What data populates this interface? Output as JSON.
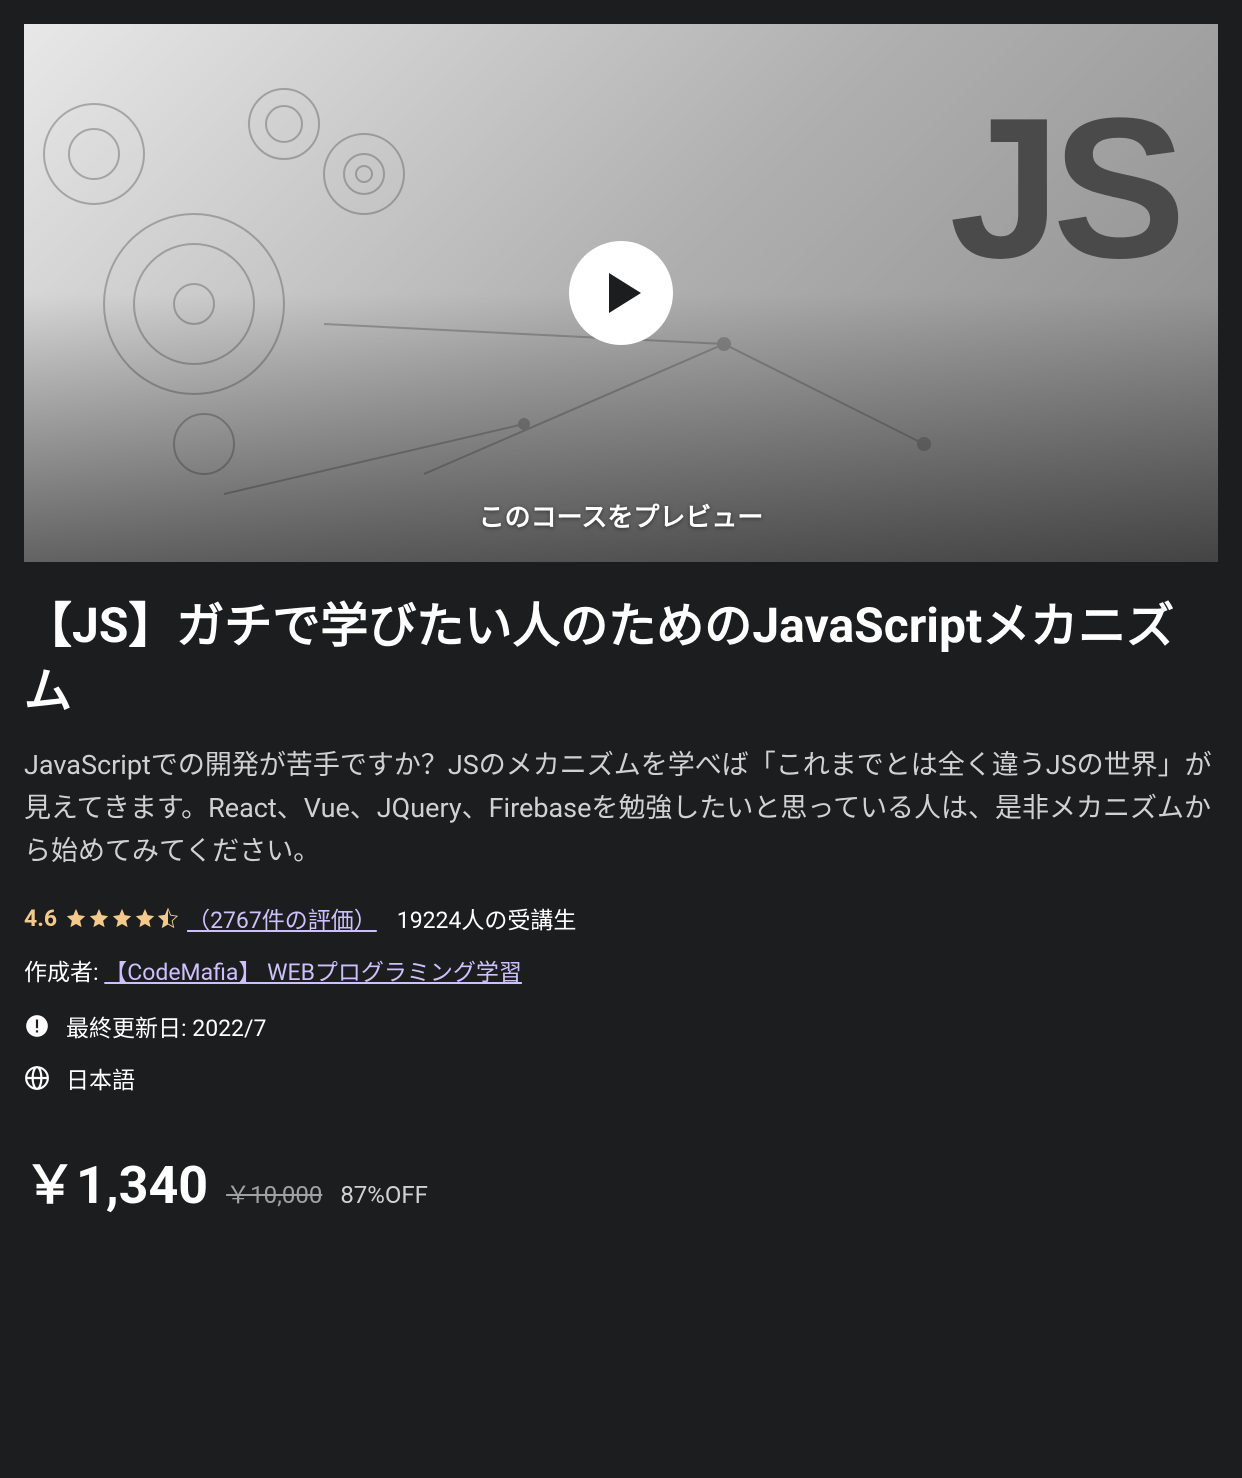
{
  "preview": {
    "label": "このコースをプレビュー",
    "logo_text": "JS"
  },
  "course": {
    "title": "【JS】ガチで学びたい人のためのJavaScriptメカニズム",
    "description": "JavaScriptでの開発が苦手ですか？JSのメカニズムを学べば「これまでとは全く違うJSの世界」が見えてきます。React、Vue、JQuery、Firebaseを勉強したいと思っている人は、是非メカニズムから始めてみてください。"
  },
  "rating": {
    "value": "4.6",
    "reviews_link": "（2767件の評価）",
    "students": "19224人の受講生"
  },
  "author": {
    "label": "作成者:",
    "name": "【CodeMafia】 WEBプログラミング学習"
  },
  "meta": {
    "updated": "最終更新日: 2022/7",
    "language": "日本語"
  },
  "price": {
    "current": "￥1,340",
    "original": "￥10,000",
    "discount": "87%OFF"
  }
}
